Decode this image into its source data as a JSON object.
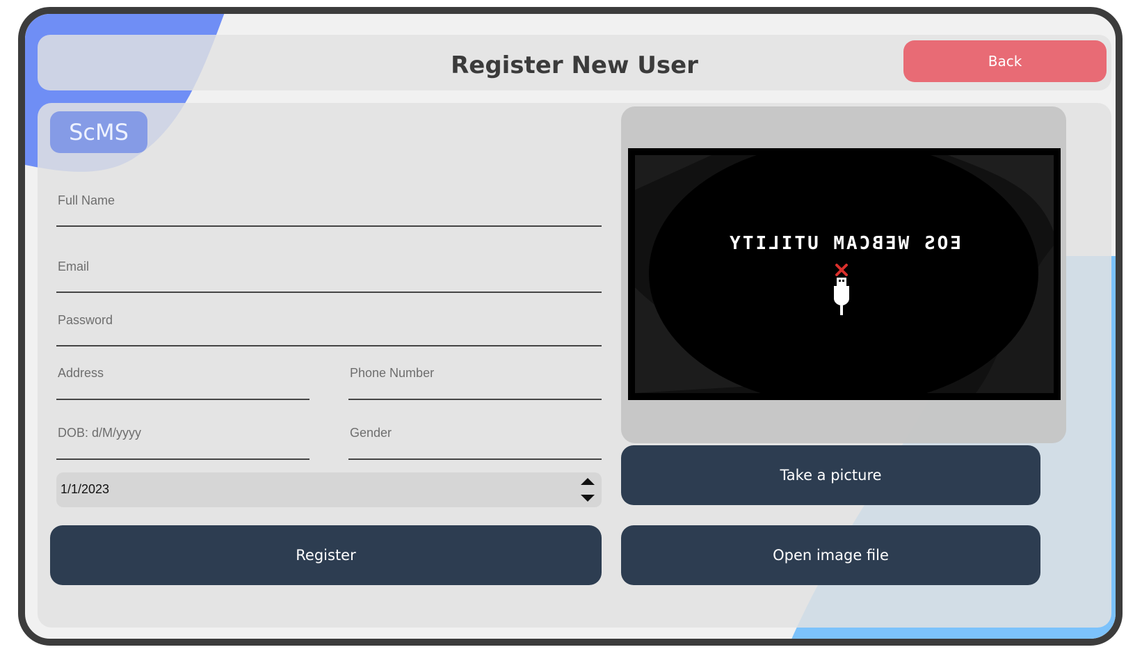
{
  "header": {
    "title": "Register New User",
    "back_label": "Back"
  },
  "logo": {
    "text": "ScMS"
  },
  "form": {
    "full_name": {
      "label": "Full Name",
      "value": ""
    },
    "email": {
      "label": "Email",
      "value": ""
    },
    "password": {
      "label": "Password",
      "value": ""
    },
    "address": {
      "label": "Address",
      "value": ""
    },
    "phone": {
      "label": "Phone Number",
      "value": ""
    },
    "dob": {
      "label": "DOB: d/M/yyyy",
      "value": ""
    },
    "gender": {
      "label": "Gender",
      "value": ""
    },
    "date_picker": {
      "value": "1/1/2023"
    }
  },
  "buttons": {
    "register": "Register",
    "take_picture": "Take a picture",
    "open_image": "Open image file"
  },
  "camera": {
    "overlay_text": "EOS WEBCAM UTILITY",
    "icons": [
      "usb-icon",
      "disconnected-x-icon"
    ]
  },
  "colors": {
    "back_button": "#e86b75",
    "primary_button": "#2d3d51",
    "accent_blue_left": "#6f8ef5",
    "accent_blue_right": "#7cc2fb"
  }
}
